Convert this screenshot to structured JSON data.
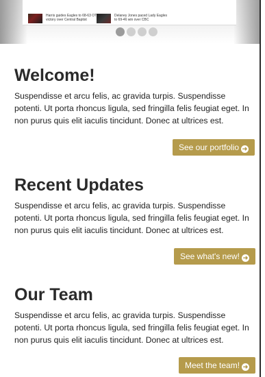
{
  "slider": {
    "news": [
      {
        "text": "Harris guides Eagles to 68-63 OT victory over Central Baptist"
      },
      {
        "text": "Delaney Jones paced Lady Eagles to 69-46 win over CBC"
      }
    ],
    "dots_count": 4,
    "active_dot": 1
  },
  "sections": [
    {
      "title": "Welcome!",
      "body": "Suspendisse et arcu felis, ac gravida turpis. Suspendisse potenti. Ut porta rhoncus ligula, sed fringilla felis feugiat eget. In non purus quis elit iaculis tincidunt. Donec at ultrices est.",
      "button": "See our portfolio"
    },
    {
      "title": "Recent Updates",
      "body": "Suspendisse et arcu felis, ac gravida turpis. Suspendisse potenti. Ut porta rhoncus ligula, sed fringilla felis feugiat eget. In non purus quis elit iaculis tincidunt. Donec at ultrices est.",
      "button": "See what's new!"
    },
    {
      "title": "Our Team",
      "body": "Suspendisse et arcu felis, ac gravida turpis. Suspendisse potenti. Ut porta rhoncus ligula, sed fringilla felis feugiat eget. In non purus quis elit iaculis tincidunt. Donec at ultrices est.",
      "button": "Meet the team!"
    }
  ],
  "colors": {
    "button_bg": "#b59b4c",
    "heading": "#2a2a2a"
  },
  "icons": {
    "button_icon": "circle-arrow-right-icon"
  }
}
